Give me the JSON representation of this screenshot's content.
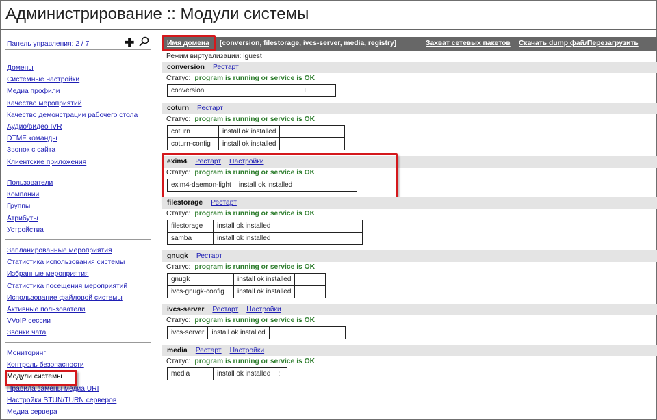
{
  "page": {
    "title": "Администрирование :: Модули системы"
  },
  "sidebar": {
    "top_link": "Панель управления: 2 / 7",
    "group1": [
      "Домены",
      "Системные настройки",
      "Медиа профили",
      "Качество мероприятий",
      "Качество демонстрации рабочего стола",
      "Аудио/видео IVR",
      "DTMF команды",
      "Звонок с сайта",
      "Клиентские приложения"
    ],
    "group2": [
      "Пользователи",
      "Компании",
      "Группы",
      "Атрибуты",
      "Устройства"
    ],
    "group3": [
      "Запланированные мероприятия",
      "Статистика использования системы",
      "Избранные мероприятия",
      "Статистика посещения мероприятий",
      "Использование файловой системы",
      "Активные пользователи",
      "VVoIP сессии",
      "Звонки чата"
    ],
    "group4": [
      "Мониторинг",
      "Контроль безопасности",
      "Модули системы",
      "Правила замены медиа URI",
      "Настройки STUN/TURN серверов",
      "Медиа сервера"
    ],
    "active": "Модули системы"
  },
  "toolbar": {
    "domain_link": "Имя домена",
    "domains": "[conversion, filestorage, ivcs-server, media, registry]",
    "capture": "Захват сетевых пакетов",
    "dump": "Скачать dump файл",
    "reboot": "Перезагрузить"
  },
  "virtualization": "Режим виртуализации:   lguest",
  "status_label": "Статус:",
  "status_ok": "program is running or service is OK",
  "restart_label": "Рестарт",
  "settings_label": "Настройки",
  "modules": [
    {
      "name": "conversion",
      "packages": [
        [
          "conversion",
          "I",
          ""
        ]
      ]
    },
    {
      "name": "coturn",
      "packages": [
        [
          "coturn",
          "install ok installed",
          ""
        ],
        [
          "coturn-config",
          "install ok installed",
          ""
        ]
      ]
    },
    {
      "name": "exim4",
      "packages": [
        [
          "exim4-daemon-light",
          "install ok installed",
          ""
        ]
      ]
    },
    {
      "name": "filestorage",
      "packages": [
        [
          "filestorage",
          "install ok installed",
          ""
        ],
        [
          "samba",
          "install ok installed",
          ""
        ]
      ]
    },
    {
      "name": "gnugk",
      "packages": [
        [
          "gnugk",
          "install ok installed",
          ""
        ],
        [
          "ivcs-gnugk-config",
          "install ok installed",
          ""
        ]
      ]
    },
    {
      "name": "ivcs-server",
      "packages": [
        [
          "ivcs-server",
          "install ok installed",
          ""
        ]
      ]
    },
    {
      "name": "media",
      "packages": [
        [
          "media",
          "install ok installed",
          ";"
        ]
      ]
    }
  ]
}
